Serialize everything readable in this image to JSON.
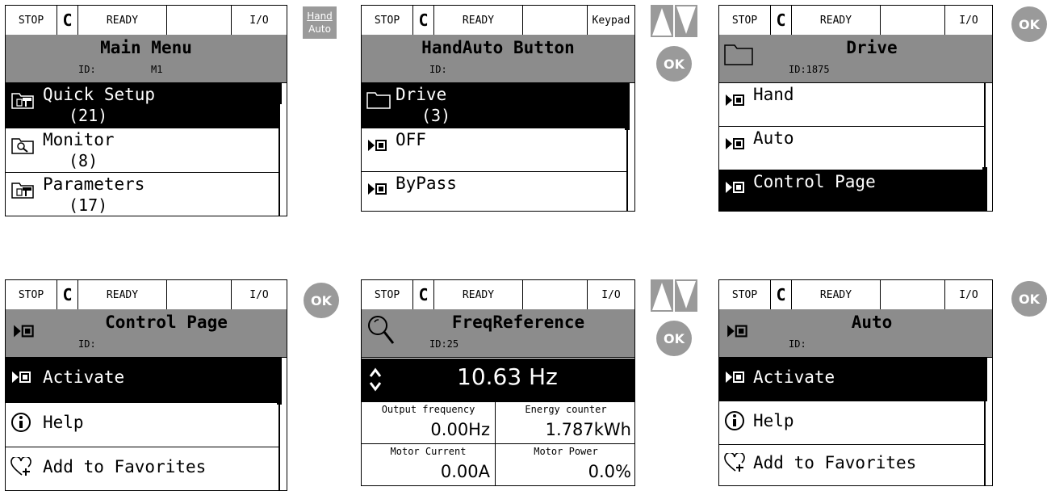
{
  "status": {
    "stop": "STOP",
    "ready": "READY",
    "io": "I/O",
    "keypad": "Keypad"
  },
  "buttons": {
    "ok": "OK",
    "hand": "Hand",
    "auto": "Auto"
  },
  "s1": {
    "title": "Main Menu",
    "id_label": "ID:",
    "id_value": "M1",
    "items": [
      {
        "label": "Quick Setup",
        "count": "(21)"
      },
      {
        "label": "Monitor",
        "count": "(8)"
      },
      {
        "label": "Parameters",
        "count": "(17)"
      }
    ]
  },
  "s2": {
    "title": "HandAuto Button",
    "id_label": "ID:",
    "items": [
      {
        "label": "Drive",
        "count": "(3)"
      },
      {
        "label": "OFF"
      },
      {
        "label": "ByPass"
      }
    ]
  },
  "s3": {
    "title": "Drive",
    "id_label": "ID:1875",
    "items": [
      {
        "label": "Hand"
      },
      {
        "label": "Auto"
      },
      {
        "label": "Control Page"
      }
    ]
  },
  "s4": {
    "title": "Control Page",
    "id_label": "ID:",
    "items": [
      {
        "label": "Activate"
      },
      {
        "label": "Help"
      },
      {
        "label": "Add to Favorites"
      }
    ]
  },
  "s5": {
    "title": "FreqReference",
    "id_label": "ID:25",
    "value": "10.63 Hz",
    "cells": [
      {
        "label": "Output frequency",
        "value": "0.00Hz"
      },
      {
        "label": "Energy counter",
        "value": "1.787kWh"
      },
      {
        "label": "Motor Current",
        "value": "0.00A"
      },
      {
        "label": "Motor Power",
        "value": "0.0%"
      }
    ]
  },
  "s6": {
    "title": "Auto",
    "id_label": "ID:",
    "items": [
      {
        "label": "Activate"
      },
      {
        "label": "Help"
      },
      {
        "label": "Add to Favorites"
      }
    ]
  }
}
